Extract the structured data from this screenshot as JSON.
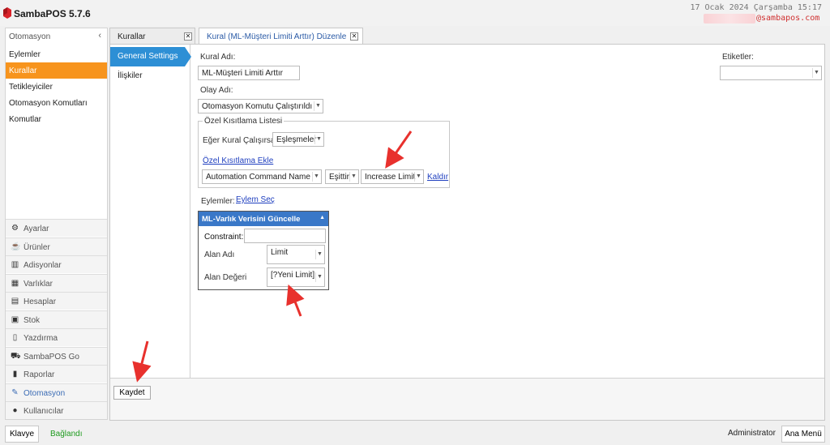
{
  "app": {
    "title": "SambaPOS 5.7.6",
    "datetime": "17 Ocak 2024 Çarşamba 15:17",
    "email": "@sambapos.com"
  },
  "sidebar": {
    "header": "Otomasyon",
    "items": [
      {
        "label": "Eylemler"
      },
      {
        "label": "Kurallar",
        "active": true
      },
      {
        "label": "Tetikleyiciler"
      },
      {
        "label": "Otomasyon Komutları"
      },
      {
        "label": "Komutlar"
      }
    ],
    "modules": [
      {
        "label": "Ayarlar",
        "icon": "gear-icon"
      },
      {
        "label": "Ürünler",
        "icon": "coffee-icon"
      },
      {
        "label": "Adisyonlar",
        "icon": "books-icon"
      },
      {
        "label": "Varlıklar",
        "icon": "table-icon"
      },
      {
        "label": "Hesaplar",
        "icon": "calculator-icon"
      },
      {
        "label": "Stok",
        "icon": "boxes-icon"
      },
      {
        "label": "Yazdırma",
        "icon": "document-icon"
      },
      {
        "label": "SambaPOS Go",
        "icon": "motorcycle-icon"
      },
      {
        "label": "Raporlar",
        "icon": "bar-chart-icon"
      },
      {
        "label": "Otomasyon",
        "icon": "pen-icon",
        "active": true
      },
      {
        "label": "Kullanıcılar",
        "icon": "user-icon"
      }
    ]
  },
  "tabs": [
    {
      "label": "Kurallar"
    },
    {
      "label": "Kural (ML-Müşteri Limiti Arttır) Düzenle",
      "active": true
    }
  ],
  "nav": {
    "general": "General Settings",
    "relations": "İlişkiler"
  },
  "form": {
    "rule_name_label": "Kural Adı:",
    "rule_name_value": "ML-Müşteri Limiti Arttır",
    "event_name_label": "Olay Adı:",
    "event_name_value": "Otomasyon Komutu Çalıştırıldı",
    "tags_label": "Etiketler:",
    "tags_value": "",
    "constraint_group_title": "Özel Kısıtlama Listesi",
    "rule_runs_label": "Eğer Kural Çalışırsa",
    "rule_runs_value": "Eşleşmeler",
    "add_constraint_link": "Özel Kısıtlama Ekle",
    "constraint_field": "Automation Command Name",
    "constraint_operator": "Eşittir",
    "constraint_value": "Increase Limit",
    "remove_link": "Kaldır",
    "actions_label": "Eylemler:",
    "select_action_link": "Eylem Seç"
  },
  "action": {
    "title": "ML-Varlık Verisini Güncelle",
    "constraint_label": "Constraint:",
    "constraint_value": "",
    "field_name_label": "Alan Adı",
    "field_name_value": "Limit",
    "field_value_label": "Alan Değeri",
    "field_value_value": "[?Yeni Limit]"
  },
  "footer": {
    "save": "Kaydet"
  },
  "statusbar": {
    "keyboard": "Klavye",
    "connected": "Bağlandı",
    "user": "Administrator",
    "main_menu": "Ana Menü"
  },
  "colors": {
    "accent_orange": "#f7941d",
    "nav_blue": "#2d8fd5",
    "header_blue": "#3a78c8",
    "annotation_red": "#e8312d"
  }
}
